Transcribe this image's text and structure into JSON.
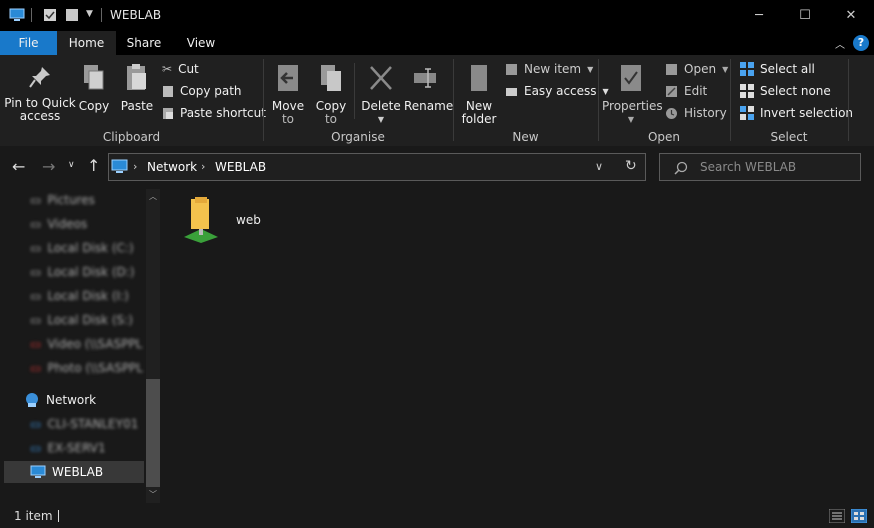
{
  "window": {
    "title": "WEBLAB",
    "minimize": "─",
    "maximize": "☐",
    "close": "✕"
  },
  "tabs": {
    "file": "File",
    "home": "Home",
    "share": "Share",
    "view": "View"
  },
  "ribbon": {
    "clipboard": {
      "label": "Clipboard",
      "pin_line1": "Pin to Quick",
      "pin_line2": "access",
      "copy": "Copy",
      "paste": "Paste",
      "cut": "Cut",
      "copy_path": "Copy path",
      "paste_shortcut": "Paste shortcut"
    },
    "organise": {
      "label": "Organise",
      "move_line1": "Move",
      "move_line2": "to",
      "copy_line1": "Copy",
      "copy_line2": "to",
      "delete": "Delete",
      "rename": "Rename"
    },
    "new": {
      "label": "New",
      "folder_line1": "New",
      "folder_line2": "folder",
      "new_item": "New item",
      "easy_access": "Easy access"
    },
    "open": {
      "label": "Open",
      "properties": "Properties",
      "open": "Open",
      "edit": "Edit",
      "history": "History"
    },
    "select": {
      "label": "Select",
      "select_all": "Select all",
      "select_none": "Select none",
      "invert": "Invert selection"
    }
  },
  "address": {
    "crumbs": [
      "Network",
      "WEBLAB"
    ],
    "sep": ">"
  },
  "search": {
    "placeholder": "Search WEBLAB"
  },
  "nav": {
    "blurred": [
      "Pictures",
      "Videos",
      "Local Disk (C:)",
      "Local Disk (D:)",
      "Local Disk (I:)",
      "Local Disk (S:)",
      "Video (\\\\SASPPL",
      "Photo (\\\\SASPPL"
    ],
    "network": "Network",
    "net_blurred": [
      "CLI-STANLEY01",
      "EX-SERV1"
    ],
    "weblab": "WEBLAB"
  },
  "content": {
    "items": [
      {
        "name": "web"
      }
    ]
  },
  "status": {
    "count": "1 item"
  },
  "colors": {
    "accent": "#1979ca",
    "selected": "#383838"
  }
}
